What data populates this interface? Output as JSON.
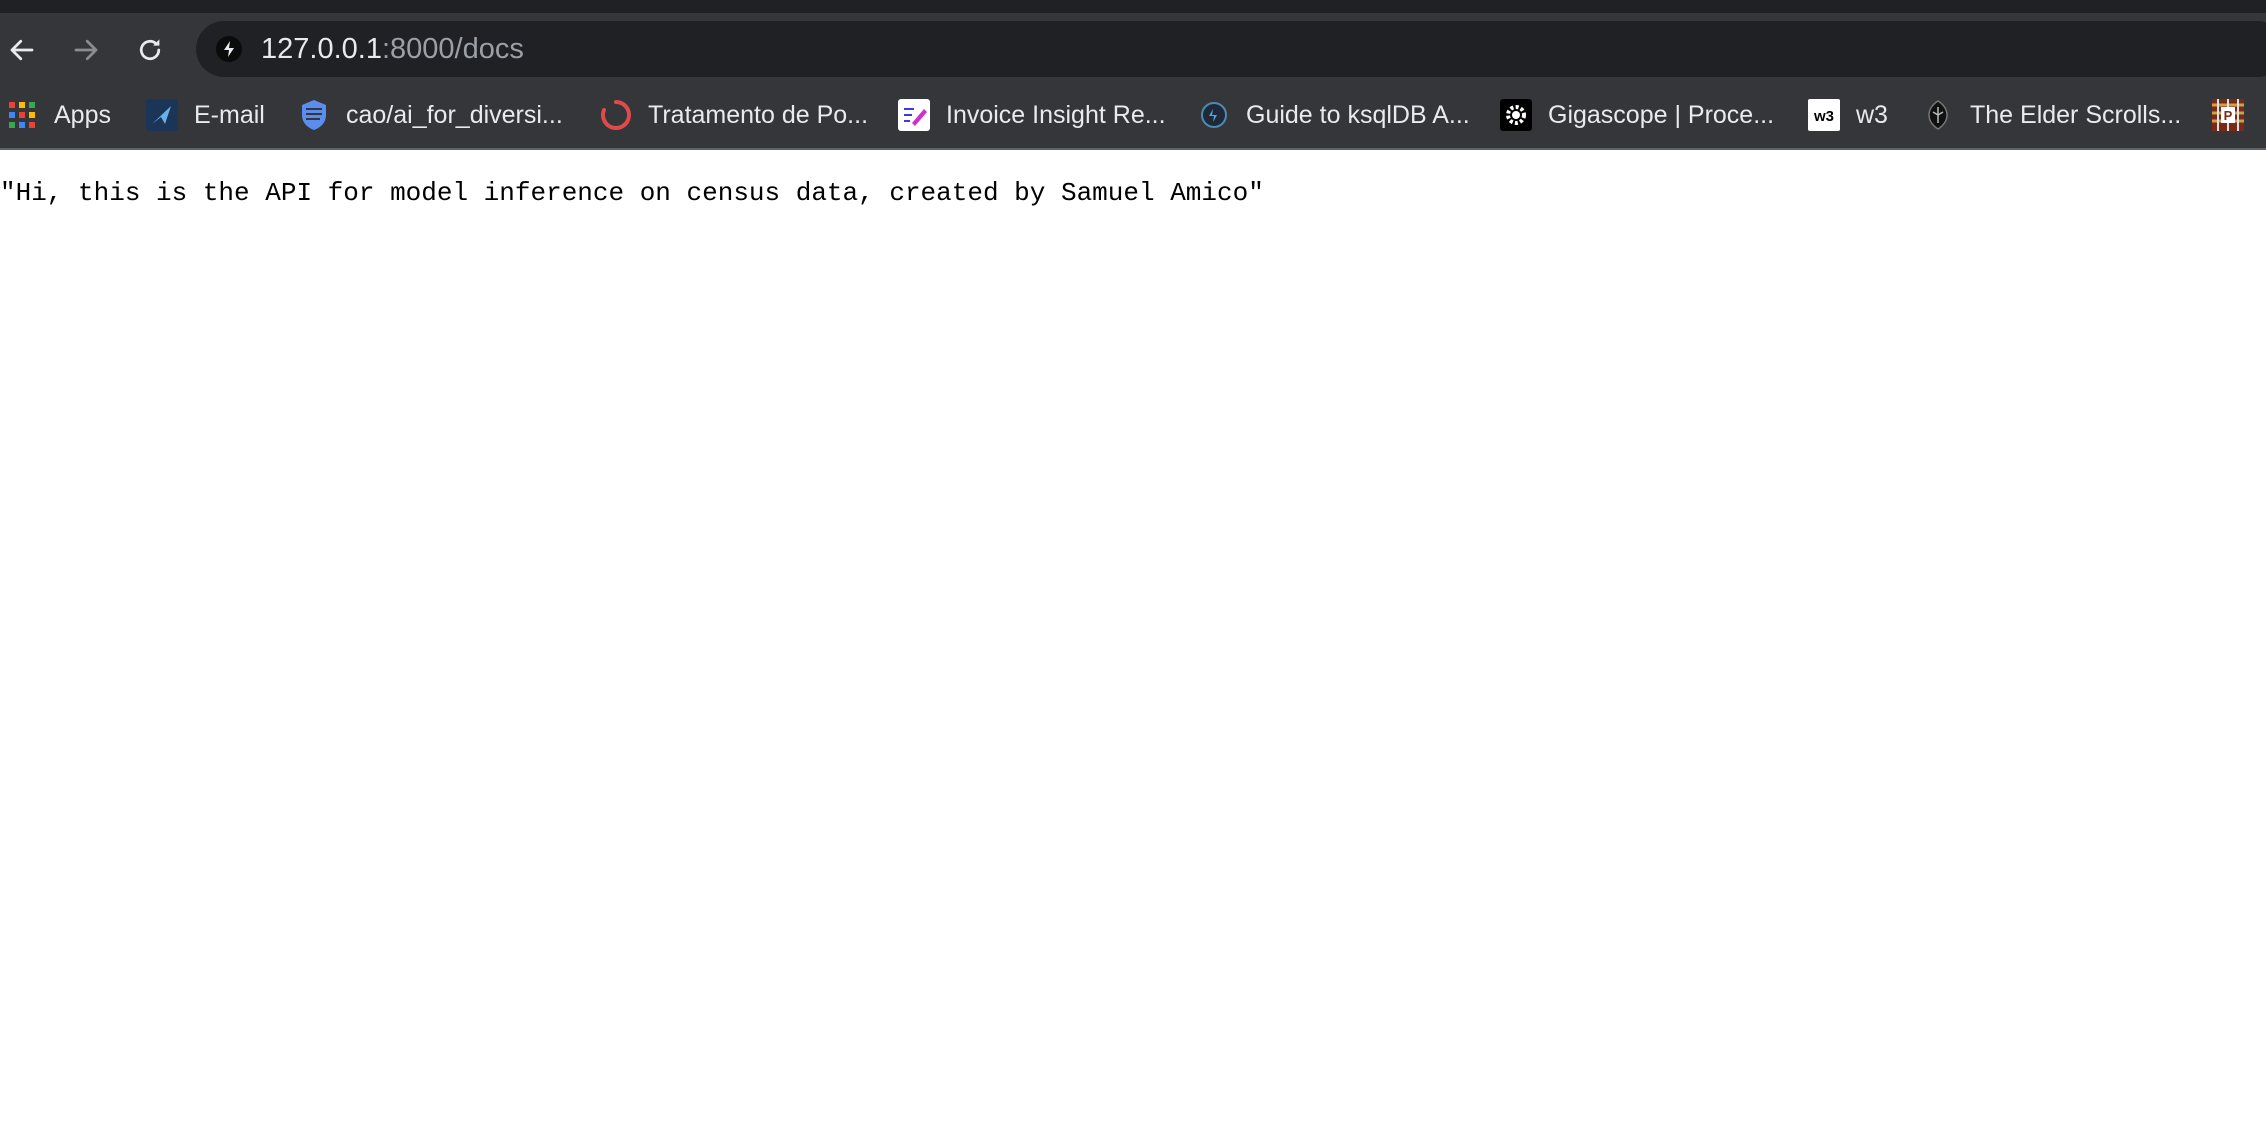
{
  "browser": {
    "address_bar": {
      "host": "127.0.0.1",
      "rest": ":8000/docs"
    },
    "bookmarks": [
      {
        "label": "Apps",
        "icon": "apps-grid-icon"
      },
      {
        "label": "E-mail",
        "icon": "email-logo-icon"
      },
      {
        "label": "cao/ai_for_diversi...",
        "icon": "shield-logo-icon"
      },
      {
        "label": "Tratamento de Po...",
        "icon": "loading-ring-icon"
      },
      {
        "label": "Invoice Insight Re...",
        "icon": "pen-logo-icon"
      },
      {
        "label": "Guide to ksqlDB A...",
        "icon": "ksqldb-logo-icon"
      },
      {
        "label": "Gigascope | Proce...",
        "icon": "gear-logo-icon"
      },
      {
        "label": "w3",
        "icon": "w3-logo-icon",
        "icon_text": "w3"
      },
      {
        "label": "The Elder Scrolls...",
        "icon": "elder-scrolls-logo-icon"
      },
      {
        "label": "",
        "icon": "plaid-logo-icon",
        "icon_text": "P"
      }
    ]
  },
  "page": {
    "body_text": "\"Hi, this is the API for model inference on census data, created by Samuel Amico\""
  },
  "colors": {
    "chrome_bg": "#35363a",
    "omnibox_bg": "#202124",
    "text_light": "#e8eaed",
    "text_dim": "#9aa0a6"
  }
}
